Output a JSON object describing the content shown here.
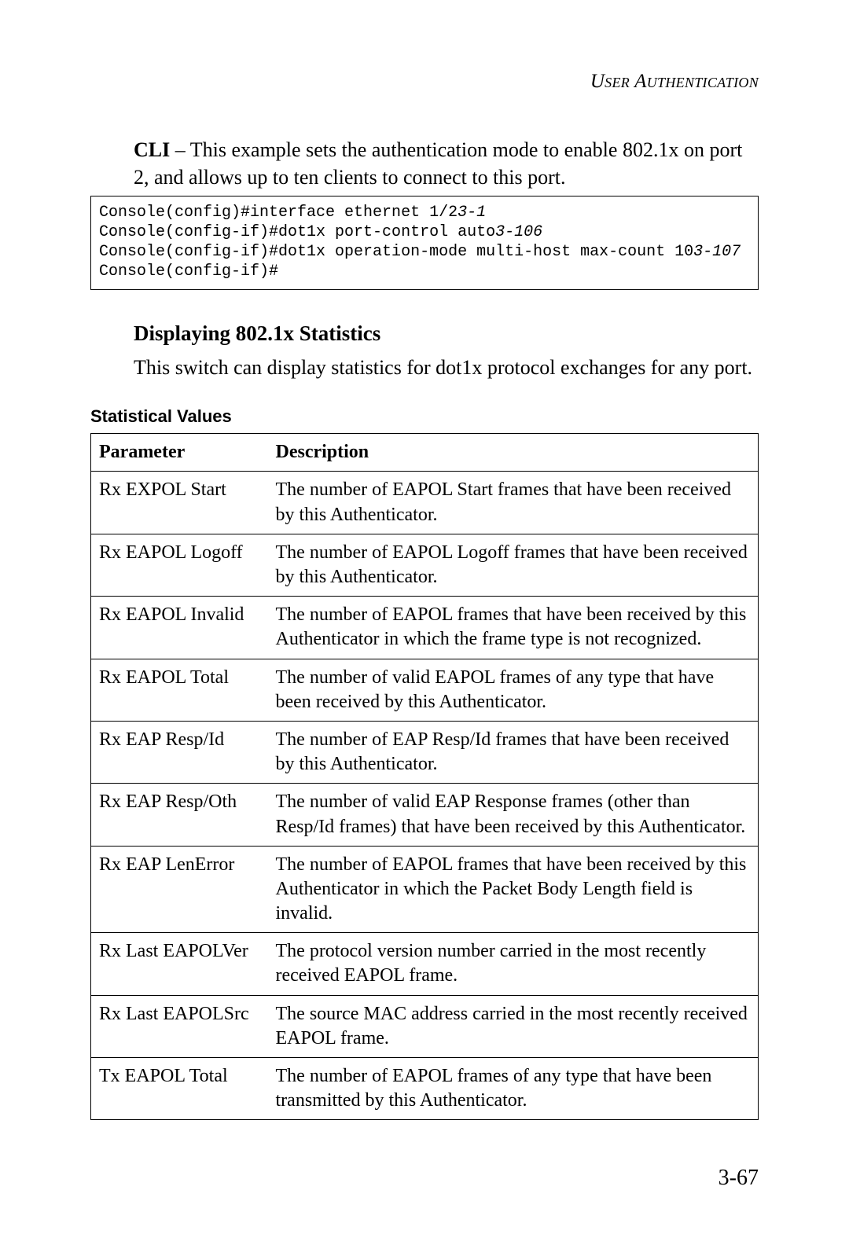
{
  "header": {
    "running": "User Authentication"
  },
  "intro": {
    "lead": "CLI",
    "text": " – This example sets the authentication mode to enable 802.1x on port 2, and allows up to ten clients to connect to this port."
  },
  "code": {
    "l1": "Console(config)#interface ethernet 1/2",
    "r1": "3-1",
    "l2": "Console(config-if)#dot1x port-control auto",
    "r2": "3-106",
    "l3": "Console(config-if)#dot1x operation-mode multi-host max-count 10",
    "r3": "3-107",
    "l4": "Console(config-if)#"
  },
  "section": {
    "title": "Displaying 802.1x Statistics",
    "desc": "This switch can display statistics for dot1x protocol exchanges for any port."
  },
  "table_title": "Statistical Values",
  "th": {
    "param": "Parameter",
    "desc": "Description"
  },
  "rows": {
    "0": {
      "p": "Rx EXPOL Start",
      "d": "The number of EAPOL Start frames that have been received by this Authenticator."
    },
    "1": {
      "p": "Rx EAPOL Logoff",
      "d": "The number of EAPOL Logoff frames that have been received by this Authenticator."
    },
    "2": {
      "p": "Rx EAPOL Invalid",
      "d": "The number of EAPOL frames that have been received by this Authenticator in which the frame type is not recognized."
    },
    "3": {
      "p": "Rx EAPOL Total",
      "d": "The number of valid EAPOL frames of any type that have been received by this Authenticator."
    },
    "4": {
      "p": "Rx EAP Resp/Id",
      "d": "The number of EAP Resp/Id frames that have been received by this Authenticator."
    },
    "5": {
      "p": "Rx EAP Resp/Oth",
      "d": "The number of valid EAP Response frames (other than Resp/Id frames) that have been received by this Authenticator."
    },
    "6": {
      "p": "Rx EAP LenError",
      "d": "The number of EAPOL frames that have been received by this Authenticator in which the Packet Body Length field is invalid."
    },
    "7": {
      "p": "Rx Last EAPOLVer",
      "d": "The protocol version number carried in the most recently received EAPOL frame."
    },
    "8": {
      "p": "Rx Last EAPOLSrc",
      "d": "The source MAC address carried in the most recently received EAPOL frame."
    },
    "9": {
      "p": "Tx EAPOL Total",
      "d": "The number of EAPOL frames of any type that have been transmitted by this Authenticator."
    }
  },
  "page_num": "3-67"
}
